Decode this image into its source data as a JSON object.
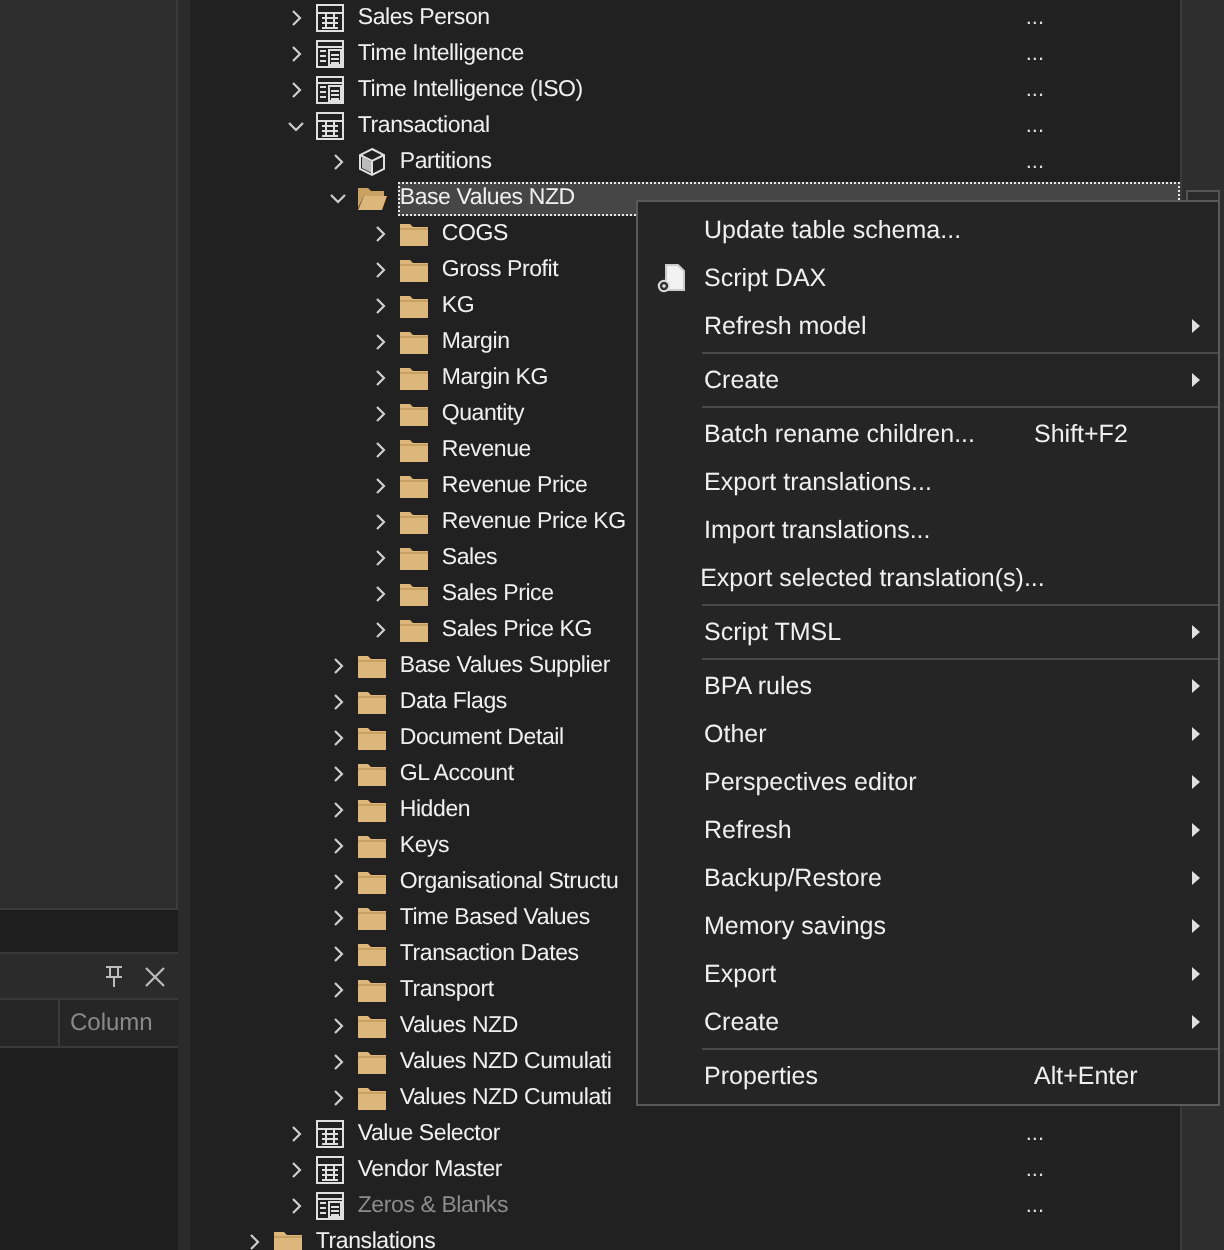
{
  "left_panel": {
    "column_header": "Column"
  },
  "tree": {
    "table_nodes": [
      {
        "label": "Sales Person",
        "kind": "table",
        "expanded": false,
        "hidden": false,
        "value": "..."
      },
      {
        "label": "Time Intelligence",
        "kind": "calc_table",
        "expanded": false,
        "hidden": false,
        "value": "..."
      },
      {
        "label": "Time Intelligence (ISO)",
        "kind": "calc_table",
        "expanded": false,
        "hidden": false,
        "value": "..."
      },
      {
        "label": "Transactional",
        "kind": "table",
        "expanded": true,
        "hidden": false,
        "value": "...",
        "children": [
          {
            "label": "Partitions",
            "kind": "partitions",
            "expanded": false,
            "hidden": false,
            "value": "..."
          },
          {
            "label": "Base Values NZD",
            "kind": "folder",
            "expanded": true,
            "hidden": false,
            "selected": true,
            "children": [
              {
                "label": "COGS",
                "kind": "folder",
                "expanded": false,
                "hidden": false
              },
              {
                "label": "Gross Profit",
                "kind": "folder",
                "expanded": false,
                "hidden": false
              },
              {
                "label": "KG",
                "kind": "folder",
                "expanded": false,
                "hidden": false
              },
              {
                "label": "Margin",
                "kind": "folder",
                "expanded": false,
                "hidden": false
              },
              {
                "label": "Margin KG",
                "kind": "folder",
                "expanded": false,
                "hidden": false
              },
              {
                "label": "Quantity",
                "kind": "folder",
                "expanded": false,
                "hidden": false
              },
              {
                "label": "Revenue",
                "kind": "folder",
                "expanded": false,
                "hidden": false
              },
              {
                "label": "Revenue Price",
                "kind": "folder",
                "expanded": false,
                "hidden": false
              },
              {
                "label": "Revenue Price KG",
                "kind": "folder",
                "expanded": false,
                "hidden": false
              },
              {
                "label": "Sales",
                "kind": "folder",
                "expanded": false,
                "hidden": false
              },
              {
                "label": "Sales Price",
                "kind": "folder",
                "expanded": false,
                "hidden": false
              },
              {
                "label": "Sales Price KG",
                "kind": "folder",
                "expanded": false,
                "hidden": false
              }
            ]
          },
          {
            "label": "Base Values Supplier",
            "kind": "folder",
            "expanded": false,
            "hidden": false
          },
          {
            "label": "Data Flags",
            "kind": "folder",
            "expanded": false,
            "hidden": false
          },
          {
            "label": "Document Detail",
            "kind": "folder",
            "expanded": false,
            "hidden": false
          },
          {
            "label": "GL Account",
            "kind": "folder",
            "expanded": false,
            "hidden": false
          },
          {
            "label": "Hidden",
            "kind": "folder",
            "expanded": false,
            "hidden": false
          },
          {
            "label": "Keys",
            "kind": "folder",
            "expanded": false,
            "hidden": false
          },
          {
            "label": "Organisational Structu",
            "kind": "folder",
            "expanded": false,
            "hidden": false
          },
          {
            "label": "Time Based Values",
            "kind": "folder",
            "expanded": false,
            "hidden": false
          },
          {
            "label": "Transaction Dates",
            "kind": "folder",
            "expanded": false,
            "hidden": false
          },
          {
            "label": "Transport",
            "kind": "folder",
            "expanded": false,
            "hidden": false
          },
          {
            "label": "Values NZD",
            "kind": "folder",
            "expanded": false,
            "hidden": false
          },
          {
            "label": "Values NZD Cumulati",
            "kind": "folder",
            "expanded": false,
            "hidden": false
          },
          {
            "label": "Values NZD Cumulati",
            "kind": "folder",
            "expanded": false,
            "hidden": false
          }
        ]
      },
      {
        "label": "Value Selector",
        "kind": "table",
        "expanded": false,
        "hidden": false,
        "value": "..."
      },
      {
        "label": "Vendor Master",
        "kind": "table",
        "expanded": false,
        "hidden": false,
        "value": "..."
      },
      {
        "label": "Zeros & Blanks",
        "kind": "calc_table",
        "expanded": false,
        "hidden": true,
        "value": "..."
      }
    ],
    "root_nodes": [
      {
        "label": "Translations",
        "kind": "folder",
        "expanded": false,
        "hidden": false
      }
    ]
  },
  "context_menu": {
    "groups": [
      [
        {
          "label": "Update table schema...",
          "submenu": false,
          "has_icon": false
        },
        {
          "label": "Script DAX",
          "submenu": false,
          "has_icon": true
        },
        {
          "label": "Refresh model",
          "submenu": true,
          "has_icon": false
        }
      ],
      [
        {
          "label": "Create",
          "submenu": true,
          "has_icon": false
        }
      ],
      [
        {
          "label": "Batch rename children...",
          "shortcut": "Shift+F2",
          "submenu": false,
          "has_icon": false
        },
        {
          "label": "Export translations...",
          "submenu": false,
          "has_icon": false
        },
        {
          "label": "Import translations...",
          "submenu": false,
          "has_icon": false
        },
        {
          "label": "Export selected translation(s)...",
          "submenu": false,
          "has_icon": false
        }
      ],
      [
        {
          "label": "Script TMSL",
          "submenu": true,
          "has_icon": false
        }
      ],
      [
        {
          "label": "BPA rules",
          "submenu": true,
          "has_icon": false
        },
        {
          "label": "Other",
          "submenu": true,
          "has_icon": false
        },
        {
          "label": "Perspectives editor",
          "submenu": true,
          "has_icon": false
        },
        {
          "label": "Refresh",
          "submenu": true,
          "has_icon": false
        },
        {
          "label": "Backup/Restore",
          "submenu": true,
          "has_icon": false
        },
        {
          "label": "Memory savings",
          "submenu": true,
          "has_icon": false
        },
        {
          "label": "Export",
          "submenu": true,
          "has_icon": false
        },
        {
          "label": "Create",
          "submenu": true,
          "has_icon": false
        }
      ],
      [
        {
          "label": "Properties",
          "shortcut": "Alt+Enter",
          "submenu": false,
          "has_icon": false
        }
      ]
    ]
  }
}
